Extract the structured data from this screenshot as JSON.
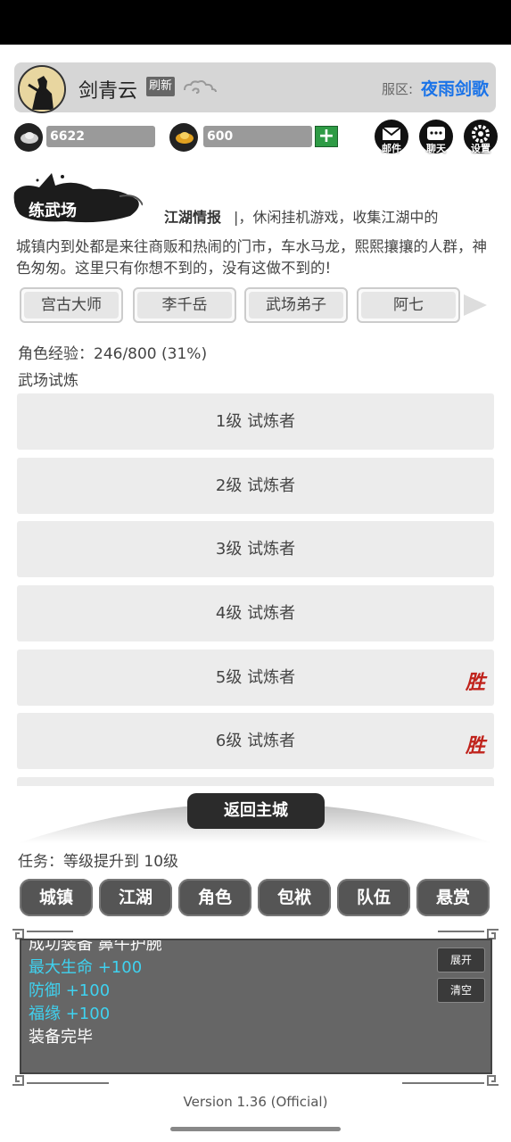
{
  "header": {
    "username": "剑青云",
    "refresh_label": "刷新",
    "server_label": "服区:",
    "server_name": "夜雨剑歌"
  },
  "currency": {
    "silver": "6622",
    "gold": "600",
    "add_symbol": "+"
  },
  "top_buttons": {
    "mail": "邮件",
    "chat": "聊天",
    "settings": "设置"
  },
  "location": {
    "name": "练武场",
    "news_label": "江湖情报",
    "news_ticker": "|，休闲挂机游戏，收集江湖中的",
    "description": "城镇内到处都是来往商贩和热闹的门市，车水马龙，熙熙攘攘的人群，神色匆匆。这里只有你想不到的，没有这做不到的!"
  },
  "npcs": [
    "宫古大师",
    "李千岳",
    "武场弟子",
    "阿七"
  ],
  "character": {
    "exp_text": "角色经验：246/800 (31%)"
  },
  "trial": {
    "title": "武场试炼",
    "rows": [
      {
        "label": "1级 试炼者",
        "stamp": ""
      },
      {
        "label": "2级 试炼者",
        "stamp": ""
      },
      {
        "label": "3级 试炼者",
        "stamp": ""
      },
      {
        "label": "4级 试炼者",
        "stamp": ""
      },
      {
        "label": "5级 试炼者",
        "stamp": "胜"
      },
      {
        "label": "6级 试炼者",
        "stamp": "胜"
      },
      {
        "label": "",
        "stamp": ""
      }
    ]
  },
  "return_label": "返回主城",
  "task_text": "任务：等级提升到 10级",
  "nav": [
    "城镇",
    "江湖",
    "角色",
    "包袱",
    "队伍",
    "悬赏"
  ],
  "log": {
    "lines": [
      {
        "text": "成功装备 鼻牛护腕",
        "color": "#ffffff"
      },
      {
        "text": "最大生命 +100",
        "color": "#3fd2f0"
      },
      {
        "text": "防御 +100",
        "color": "#3fd2f0"
      },
      {
        "text": "福缘 +100",
        "color": "#3fd2f0"
      },
      {
        "text": "装备完毕",
        "color": "#ffffff"
      }
    ],
    "expand_label": "展开",
    "clear_label": "清空"
  },
  "version": "Version 1.36 (Official)"
}
